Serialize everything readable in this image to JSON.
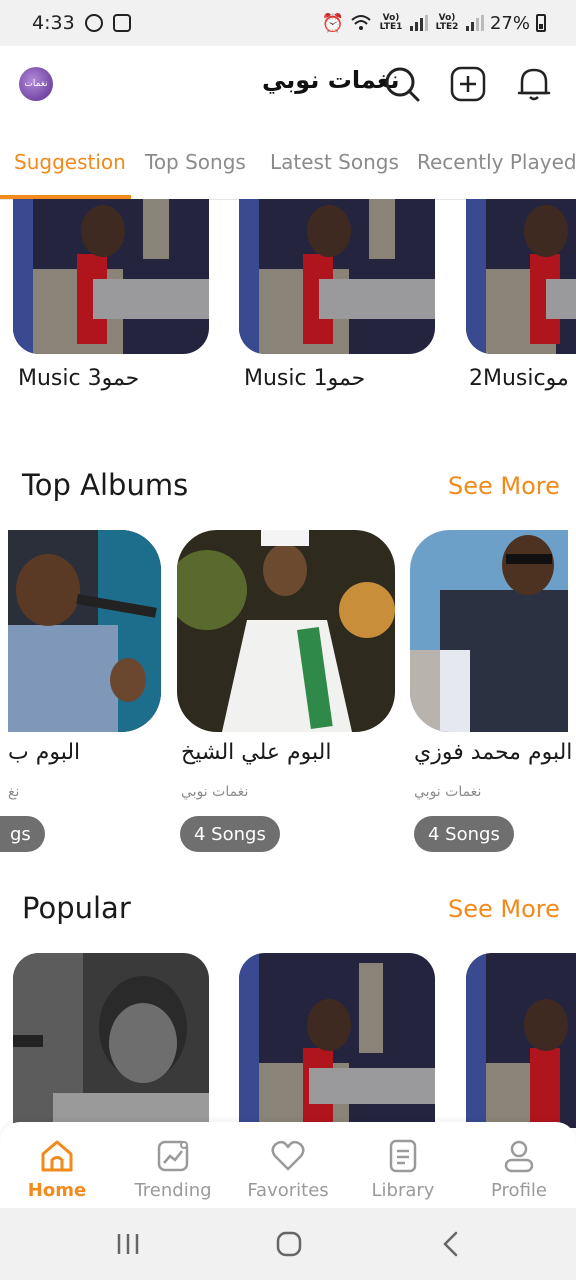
{
  "status_bar": {
    "time": "4:33",
    "lte1": "Vo) LTE1",
    "lte2": "Vo) LTE2",
    "battery": "27%"
  },
  "header": {
    "app_title": "نغمات نوبي",
    "logo_text": "نغمات"
  },
  "tabs": [
    {
      "label": "Suggestion",
      "active": true
    },
    {
      "label": "Top Songs",
      "active": false
    },
    {
      "label": "Latest Songs",
      "active": false
    },
    {
      "label": "Recently Played",
      "active": false
    }
  ],
  "suggestions": [
    {
      "title": "Music 3حمو"
    },
    {
      "title": "Music 1حمو"
    },
    {
      "title": "2Musicمو"
    }
  ],
  "top_albums": {
    "title": "Top Albums",
    "see_more": "See More",
    "items": [
      {
        "title": "البوم ب",
        "artist": "نغ",
        "songs": "gs"
      },
      {
        "title": "البوم علي الشيخ",
        "artist": "نغمات نوبي",
        "songs": "4 Songs"
      },
      {
        "title": "البوم محمد فوزي",
        "artist": "نغمات نوبي",
        "songs": "4 Songs"
      }
    ]
  },
  "popular": {
    "title": "Popular",
    "see_more": "See More"
  },
  "bottom_nav": [
    {
      "label": "Home",
      "active": true
    },
    {
      "label": "Trending",
      "active": false
    },
    {
      "label": "Favorites",
      "active": false
    },
    {
      "label": "Library",
      "active": false
    },
    {
      "label": "Profile",
      "active": false
    }
  ],
  "colors": {
    "accent": "#f28a1c",
    "pill": "#6f6f6f",
    "inactive": "#9a9a9a"
  }
}
